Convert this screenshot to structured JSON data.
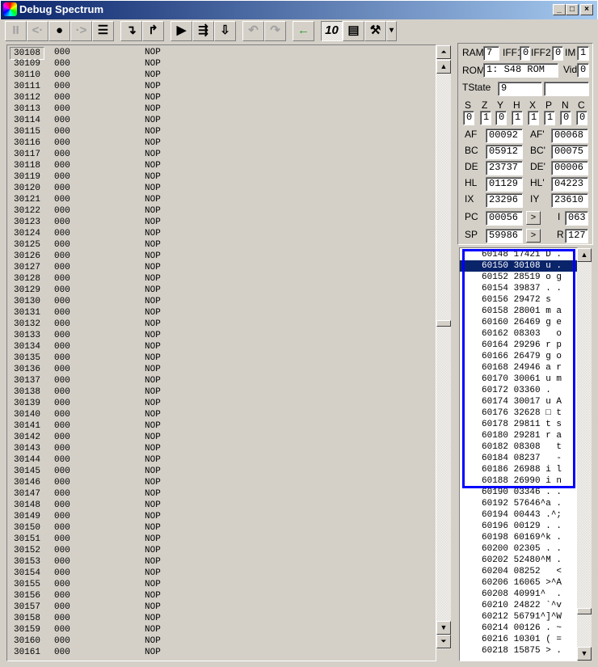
{
  "window": {
    "title": "Debug Spectrum",
    "minimize": "_",
    "maximize": "□",
    "close": "×"
  },
  "toolbar": {
    "buttons": [
      {
        "name": "pause",
        "glyph": "II",
        "enabled": false
      },
      {
        "name": "step-back",
        "glyph": "<·",
        "enabled": false
      },
      {
        "name": "breakpoint",
        "glyph": "●",
        "enabled": true
      },
      {
        "name": "step-forward",
        "glyph": "·>",
        "enabled": false
      },
      {
        "name": "list",
        "glyph": "☰",
        "enabled": true
      },
      {
        "name": "step-into",
        "glyph": "↴",
        "enabled": true
      },
      {
        "name": "step-over",
        "glyph": "↱",
        "enabled": true
      },
      {
        "name": "run",
        "glyph": "▶",
        "enabled": true
      },
      {
        "name": "run-to",
        "glyph": "⇶",
        "enabled": true
      },
      {
        "name": "run-frame",
        "glyph": "⇩",
        "enabled": true
      },
      {
        "name": "undo",
        "glyph": "↶",
        "enabled": false
      },
      {
        "name": "redo",
        "glyph": "↷",
        "enabled": false
      },
      {
        "name": "back",
        "glyph": "←",
        "enabled": true
      },
      {
        "name": "decimal-mode",
        "glyph": "10",
        "enabled": true
      },
      {
        "name": "memory",
        "glyph": "▤",
        "enabled": true
      },
      {
        "name": "tools",
        "glyph": "⚒",
        "enabled": true
      },
      {
        "name": "more",
        "glyph": "▾",
        "enabled": true
      }
    ]
  },
  "disassembly": {
    "rows": [
      [
        "30108",
        "000",
        "NOP"
      ],
      [
        "30109",
        "000",
        "NOP"
      ],
      [
        "30110",
        "000",
        "NOP"
      ],
      [
        "30111",
        "000",
        "NOP"
      ],
      [
        "30112",
        "000",
        "NOP"
      ],
      [
        "30113",
        "000",
        "NOP"
      ],
      [
        "30114",
        "000",
        "NOP"
      ],
      [
        "30115",
        "000",
        "NOP"
      ],
      [
        "30116",
        "000",
        "NOP"
      ],
      [
        "30117",
        "000",
        "NOP"
      ],
      [
        "30118",
        "000",
        "NOP"
      ],
      [
        "30119",
        "000",
        "NOP"
      ],
      [
        "30120",
        "000",
        "NOP"
      ],
      [
        "30121",
        "000",
        "NOP"
      ],
      [
        "30122",
        "000",
        "NOP"
      ],
      [
        "30123",
        "000",
        "NOP"
      ],
      [
        "30124",
        "000",
        "NOP"
      ],
      [
        "30125",
        "000",
        "NOP"
      ],
      [
        "30126",
        "000",
        "NOP"
      ],
      [
        "30127",
        "000",
        "NOP"
      ],
      [
        "30128",
        "000",
        "NOP"
      ],
      [
        "30129",
        "000",
        "NOP"
      ],
      [
        "30130",
        "000",
        "NOP"
      ],
      [
        "30131",
        "000",
        "NOP"
      ],
      [
        "30132",
        "000",
        "NOP"
      ],
      [
        "30133",
        "000",
        "NOP"
      ],
      [
        "30134",
        "000",
        "NOP"
      ],
      [
        "30135",
        "000",
        "NOP"
      ],
      [
        "30136",
        "000",
        "NOP"
      ],
      [
        "30137",
        "000",
        "NOP"
      ],
      [
        "30138",
        "000",
        "NOP"
      ],
      [
        "30139",
        "000",
        "NOP"
      ],
      [
        "30140",
        "000",
        "NOP"
      ],
      [
        "30141",
        "000",
        "NOP"
      ],
      [
        "30142",
        "000",
        "NOP"
      ],
      [
        "30143",
        "000",
        "NOP"
      ],
      [
        "30144",
        "000",
        "NOP"
      ],
      [
        "30145",
        "000",
        "NOP"
      ],
      [
        "30146",
        "000",
        "NOP"
      ],
      [
        "30147",
        "000",
        "NOP"
      ],
      [
        "30148",
        "000",
        "NOP"
      ],
      [
        "30149",
        "000",
        "NOP"
      ],
      [
        "30150",
        "000",
        "NOP"
      ],
      [
        "30151",
        "000",
        "NOP"
      ],
      [
        "30152",
        "000",
        "NOP"
      ],
      [
        "30153",
        "000",
        "NOP"
      ],
      [
        "30154",
        "000",
        "NOP"
      ],
      [
        "30155",
        "000",
        "NOP"
      ],
      [
        "30156",
        "000",
        "NOP"
      ],
      [
        "30157",
        "000",
        "NOP"
      ],
      [
        "30158",
        "000",
        "NOP"
      ],
      [
        "30159",
        "000",
        "NOP"
      ],
      [
        "30160",
        "000",
        "NOP"
      ],
      [
        "30161",
        "000",
        "NOP"
      ]
    ]
  },
  "registers": {
    "ram": {
      "label": "RAM",
      "value": "7"
    },
    "iff1": {
      "label": "IFF1",
      "value": "0"
    },
    "iff2": {
      "label": "IFF2",
      "value": "0"
    },
    "im": {
      "label": "IM",
      "value": "1"
    },
    "rom": {
      "label": "ROM",
      "value": "1: S48 ROM"
    },
    "vid": {
      "label": "Vid",
      "value": "0"
    },
    "tstate": {
      "label": "TState",
      "value": "9",
      "extra": ""
    },
    "flags": [
      {
        "label": "S",
        "value": "0"
      },
      {
        "label": "Z",
        "value": "1"
      },
      {
        "label": "Y",
        "value": "0"
      },
      {
        "label": "H",
        "value": "1"
      },
      {
        "label": "X",
        "value": "1"
      },
      {
        "label": "P",
        "value": "1"
      },
      {
        "label": "N",
        "value": "0"
      },
      {
        "label": "C",
        "value": "0"
      }
    ],
    "pairs": [
      {
        "l": "AF",
        "v": "00092",
        "l2": "AF'",
        "v2": "00068"
      },
      {
        "l": "BC",
        "v": "05912",
        "l2": "BC'",
        "v2": "00075"
      },
      {
        "l": "DE",
        "v": "23737",
        "l2": "DE'",
        "v2": "00006"
      },
      {
        "l": "HL",
        "v": "01129",
        "l2": "HL'",
        "v2": "04223"
      },
      {
        "l": "IX",
        "v": "23296",
        "l2": "IY",
        "v2": "23610"
      }
    ],
    "pc": {
      "label": "PC",
      "value": "00056",
      "goto": ">"
    },
    "i": {
      "label": "I",
      "value": "063"
    },
    "sp": {
      "label": "SP",
      "value": "59986",
      "goto": ">"
    },
    "r": {
      "label": "R",
      "value": "127"
    }
  },
  "stack": {
    "selected_index": 1,
    "highlight_color": "#0000ff",
    "rows": [
      "60148 17421 D .",
      "60150 30108 u .",
      "60152 28519 o g",
      "60154 39837 . .",
      "60156 29472 s",
      "60158 28001 m a",
      "60160 26469 g e",
      "60162 08303   o",
      "60164 29296 r p",
      "60166 26479 g o",
      "60168 24946 a r",
      "60170 30061 u m",
      "60172 03360 .",
      "60174 30017 u A",
      "60176 32628 □ t",
      "60178 29811 t s",
      "60180 29281 r a",
      "60182 08308   t",
      "60184 08237   -",
      "60186 26988 i l",
      "60188 26990 i n",
      "60190 03346 . .",
      "60192 57646^a .",
      "60194 00443 .^;",
      "60196 00129 . .",
      "60198 60169^k .",
      "60200 02305 . .",
      "60202 52480^M .",
      "60204 08252   <",
      "60206 16065 >^A",
      "60208 40991^  .",
      "60210 24822 `^v",
      "60212 56791^]^W",
      "60214 00126 . ~",
      "60216 10301 ( =",
      "60218 15875 > ."
    ]
  }
}
